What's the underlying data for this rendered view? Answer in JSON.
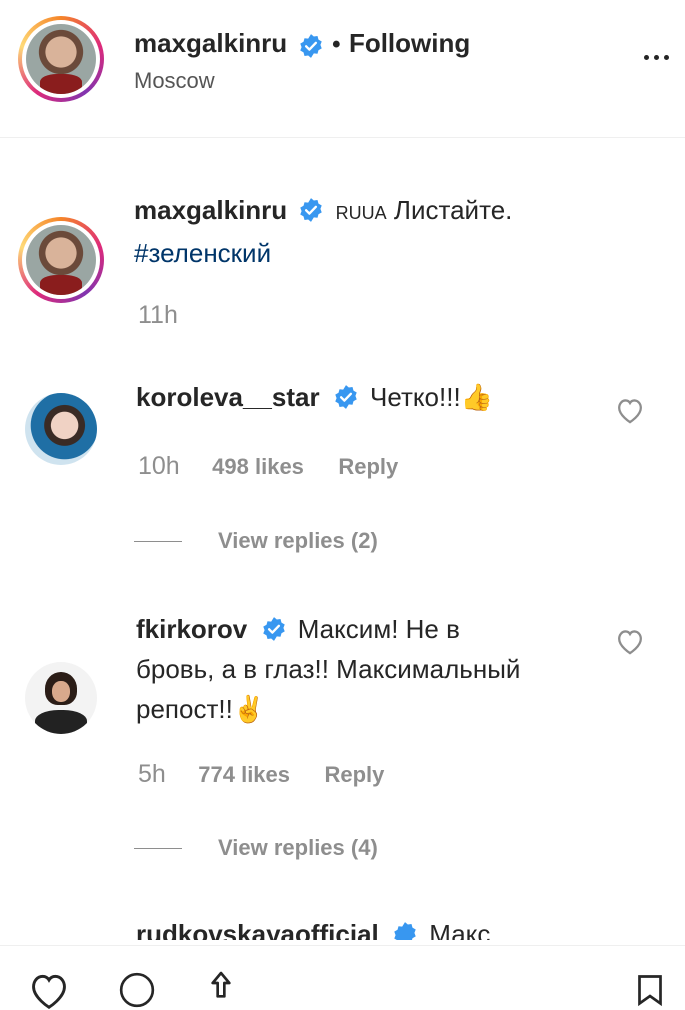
{
  "header": {
    "username": "maxgalkinru",
    "separator": "•",
    "follow_label": "Following",
    "location": "Moscow"
  },
  "caption": {
    "username": "maxgalkinru",
    "prefix": "RUUA",
    "text": "Листайте.",
    "hashtag": "#зеленский",
    "time": "11h"
  },
  "comments": [
    {
      "username": "koroleva__star",
      "text": "Четко!!!👍",
      "time": "10h",
      "likes": "498 likes",
      "reply": "Reply",
      "view_replies": "View replies (2)"
    },
    {
      "username": "fkirkorov",
      "text_line1": "Максим! Не в",
      "text_line2": "бровь, а в глаз!! Максимальный",
      "text_line3": "репост!!✌️",
      "time": "5h",
      "likes": "774 likes",
      "reply": "Reply",
      "view_replies": "View replies (4)"
    },
    {
      "username": "rudkovskayaofficial",
      "text": "Макс"
    }
  ],
  "colors": {
    "verified": "#3897f0",
    "muted": "#8e8e8e",
    "hashtag": "#003569"
  }
}
